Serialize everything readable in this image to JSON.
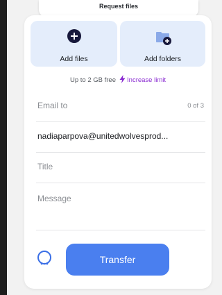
{
  "header": {
    "request_files_label": "Request files"
  },
  "upload": {
    "add_files_label": "Add files",
    "add_folders_label": "Add folders",
    "limit_text": "Up to 2 GB free",
    "increase_limit_label": "Increase limit"
  },
  "form": {
    "email_to_placeholder": "Email to",
    "recipient_count": "0 of 3",
    "recipient_email": "nadiaparpova@unitedwolvesprod...",
    "title_placeholder": "Title",
    "message_placeholder": "Message"
  },
  "footer": {
    "more_options_icon": "ellipsis-circle-icon",
    "transfer_label": "Transfer"
  },
  "colors": {
    "accent_blue": "#4a7fef",
    "tile_background": "#e4edfb",
    "increase_limit_purple": "#8a2bd1",
    "icon_navy": "#17183b"
  }
}
